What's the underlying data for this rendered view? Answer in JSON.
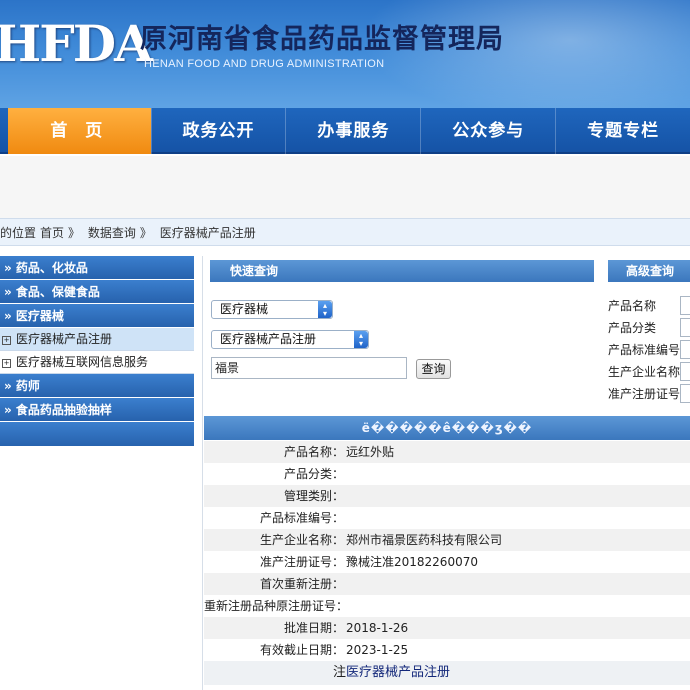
{
  "header": {
    "logo_text": "HFDA",
    "title": "原河南省食品药品监督管理局",
    "subtitle": "HENAN FOOD AND DRUG ADMINISTRATION"
  },
  "nav": {
    "items": [
      "首 页",
      "政务公开",
      "办事服务",
      "公众参与",
      "专题专栏"
    ]
  },
  "breadcrumb": {
    "prefix": "的位置",
    "home": "首页",
    "sep1": "》",
    "level1": "数据查询",
    "sep2": "》",
    "level2": "医疗器械产品注册"
  },
  "sidebar": {
    "categories": [
      {
        "label": "» 药品、化妆品"
      },
      {
        "label": "» 食品、保健食品"
      },
      {
        "label": "» 医疗器械"
      }
    ],
    "sub_items": [
      {
        "label": "医疗器械产品注册",
        "active": true
      },
      {
        "label": "医疗器械互联网信息服务",
        "active": false
      }
    ],
    "more_categories": [
      {
        "label": "» 药师"
      },
      {
        "label": "» 食品药品抽验抽样"
      }
    ]
  },
  "quick_query": {
    "title": "快速查询",
    "select1": "医疗器械",
    "select2": "医疗器械产品注册",
    "keyword": "福景",
    "button": "查询"
  },
  "advanced_query": {
    "title": "高级查询",
    "labels": [
      "产品名称",
      "产品分类",
      "产品标准编号",
      "生产企业名称",
      "准产注册证号"
    ]
  },
  "result": {
    "header": "ë�����ê���ʒ��",
    "rows": [
      {
        "label": "产品名称：",
        "value": "远红外贴"
      },
      {
        "label": "产品分类：",
        "value": ""
      },
      {
        "label": "管理类别：",
        "value": ""
      },
      {
        "label": "产品标准编号：",
        "value": ""
      },
      {
        "label": "生产企业名称：",
        "value": "郑州市福景医药科技有限公司"
      },
      {
        "label": "准产注册证号：",
        "value": "豫械注准20182260070"
      },
      {
        "label": "首次重新注册：",
        "value": ""
      },
      {
        "label": "重新注册品种原注册证号：",
        "value": ""
      },
      {
        "label": "批准日期：",
        "value": "2018-1-26"
      },
      {
        "label": "有效截止日期：",
        "value": "2023-1-25"
      }
    ],
    "footer_prefix": "注",
    "footer_link": "医疗器械产品注册"
  }
}
